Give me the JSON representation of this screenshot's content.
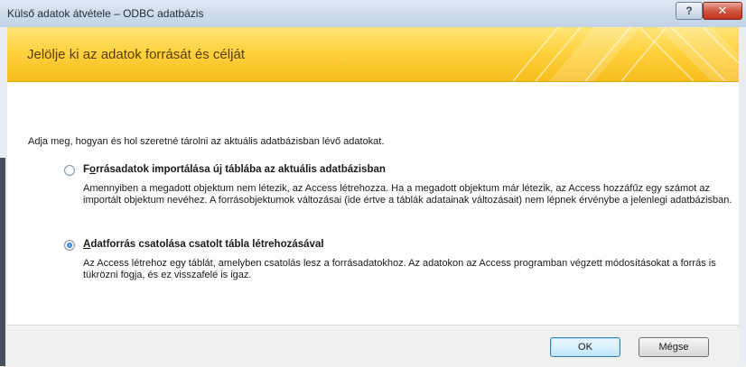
{
  "window": {
    "title": "Külső adatok átvétele – ODBC adatbázis",
    "help_icon": "question-mark",
    "help_symbol": "?",
    "close_icon": "x-close",
    "close_symbol": "✕"
  },
  "banner": {
    "heading": "Jelölje ki az adatok forrását és célját",
    "accent_color": "#ffd23f"
  },
  "intro": "Adja meg, hogyan és hol szeretné tárolni az aktuális adatbázisban lévő adatokat.",
  "options": [
    {
      "hotkey": "o",
      "label_pre": "F",
      "label_post": "rrásadatok importálása új táblába az aktuális adatbázisban",
      "description": "Amennyiben a megadott objektum nem létezik, az Access létrehozza. Ha a megadott objektum már létezik, az Access hozzáfűz egy számot az importált objektum nevéhez. A forrásobjektumok változásai (ide értve a táblák adatainak változásait) nem lépnek érvénybe a jelenlegi adatbázisban.",
      "selected": false
    },
    {
      "hotkey": "A",
      "label_pre": "",
      "label_post": "datforrás csatolása csatolt tábla létrehozásával",
      "description": "Az Access létrehoz egy táblát, amelyben csatolás lesz a forrásadatokhoz. Az adatokon az Access programban végzett módosításokat a forrás is tükrözni fogja, és ez visszafelé is igaz.",
      "selected": true
    }
  ],
  "buttons": {
    "ok": "OK",
    "cancel": "Mégse"
  }
}
